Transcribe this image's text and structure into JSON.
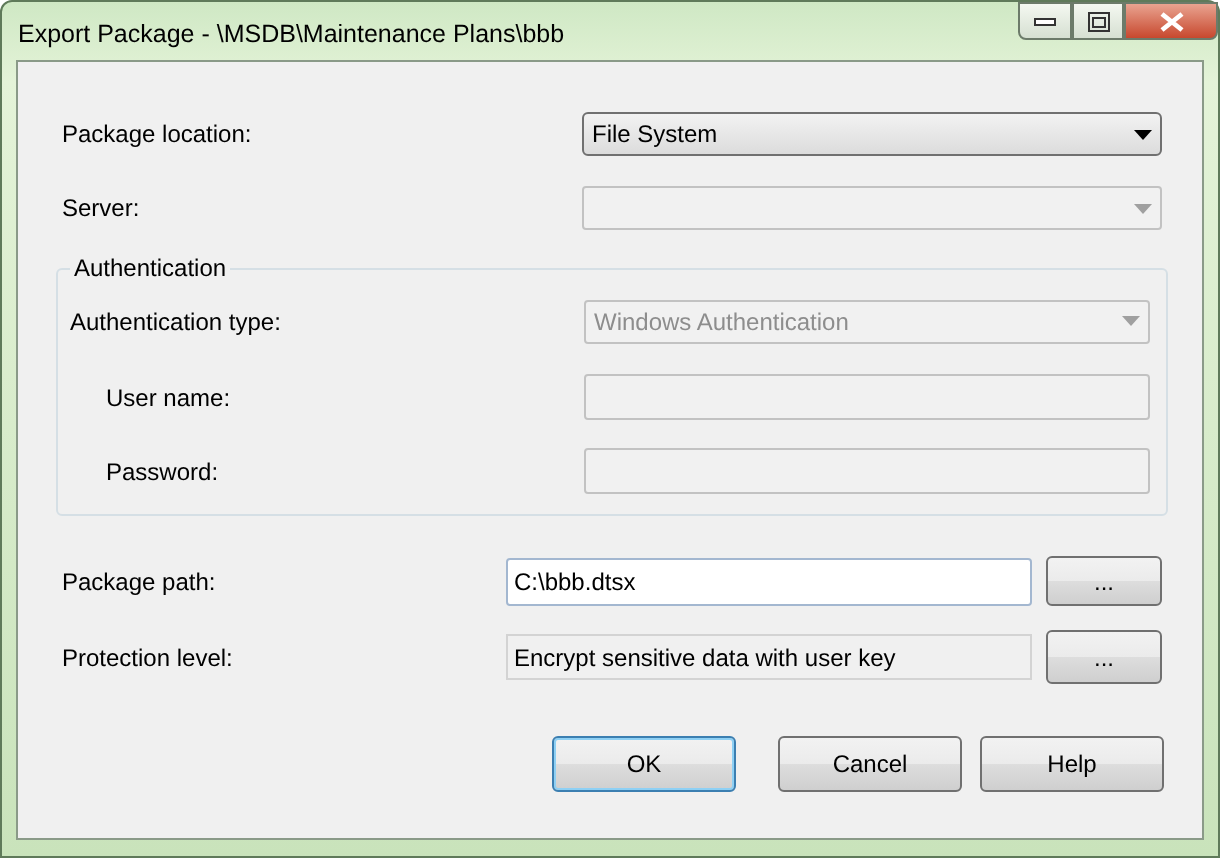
{
  "window": {
    "title": "Export Package - \\MSDB\\Maintenance Plans\\bbb"
  },
  "fields": [
    {
      "label": "Package location:",
      "kind": "select",
      "value": "File System",
      "disabled": false
    },
    {
      "label": "Server:",
      "kind": "select",
      "disabled": true
    }
  ],
  "authentication": {
    "title": "Authentication",
    "fields": [
      {
        "label": "Authentication type:",
        "kind": "select",
        "value": "Windows Authentication",
        "disabled": true,
        "indented": false
      },
      {
        "label": "User name:",
        "kind": "text",
        "disabled": true,
        "indented": true
      },
      {
        "label": "Password:",
        "kind": "text",
        "disabled": true,
        "indented": true
      }
    ]
  },
  "package_path": {
    "label": "Package path:",
    "value": "C:\\bbb.dtsx",
    "browse": "..."
  },
  "protection_level": {
    "label": "Protection level:",
    "value": "Encrypt sensitive data with user key",
    "browse": "..."
  },
  "buttons": [
    {
      "label": "OK",
      "default": true
    },
    {
      "label": "Cancel",
      "default": false
    },
    {
      "label": "Help",
      "default": false
    }
  ]
}
